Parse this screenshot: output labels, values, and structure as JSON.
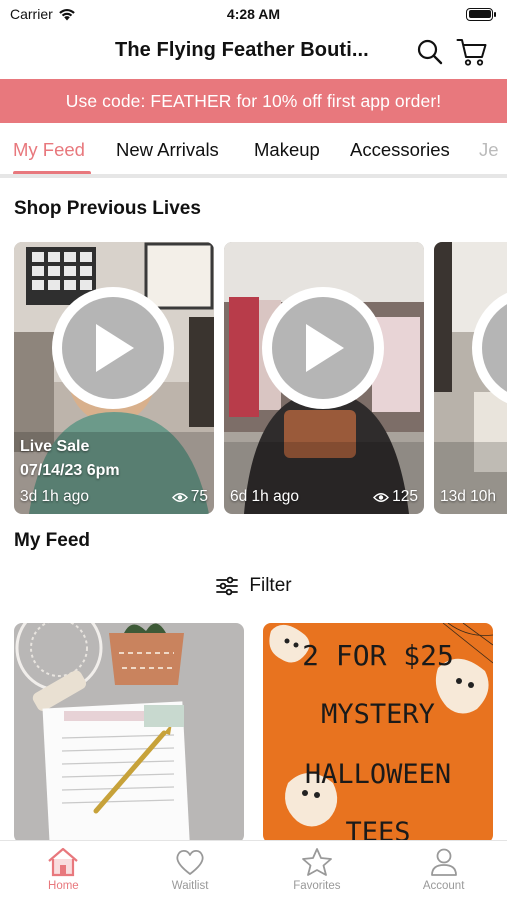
{
  "status_bar": {
    "carrier": "Carrier",
    "time": "4:28 AM"
  },
  "header": {
    "title": "The Flying Feather Bouti..."
  },
  "promo": {
    "text": "Use code: FEATHER for 10% off first app order!"
  },
  "tabs": [
    {
      "label": "My Feed",
      "active": true
    },
    {
      "label": "New Arrivals"
    },
    {
      "label": "Makeup"
    },
    {
      "label": "Accessories"
    },
    {
      "label": "Je"
    }
  ],
  "sections": {
    "previous_lives": "Shop Previous Lives",
    "my_feed": "My Feed"
  },
  "lives": [
    {
      "caption_line1": "Live Sale",
      "caption_line2": "07/14/23 6pm",
      "ago": "3d 1h ago",
      "views": "75"
    },
    {
      "ago": "6d 1h ago",
      "views": "125"
    },
    {
      "ago": "13d 10h"
    }
  ],
  "filter": {
    "label": "Filter"
  },
  "products": [
    {
      "image": "planner-notepad-photo"
    },
    {
      "image": "halloween-tees-graphic",
      "graphic_text": [
        "2 FOR $25",
        "MYSTERY",
        "HALLOWEEN",
        "TEES"
      ]
    }
  ],
  "bottom_nav": [
    {
      "label": "Home",
      "icon": "home-icon",
      "active": true
    },
    {
      "label": "Waitlist",
      "icon": "heart-icon"
    },
    {
      "label": "Favorites",
      "icon": "star-icon"
    },
    {
      "label": "Account",
      "icon": "account-icon"
    }
  ],
  "colors": {
    "accent": "#e8787d",
    "inactive": "#999999"
  }
}
